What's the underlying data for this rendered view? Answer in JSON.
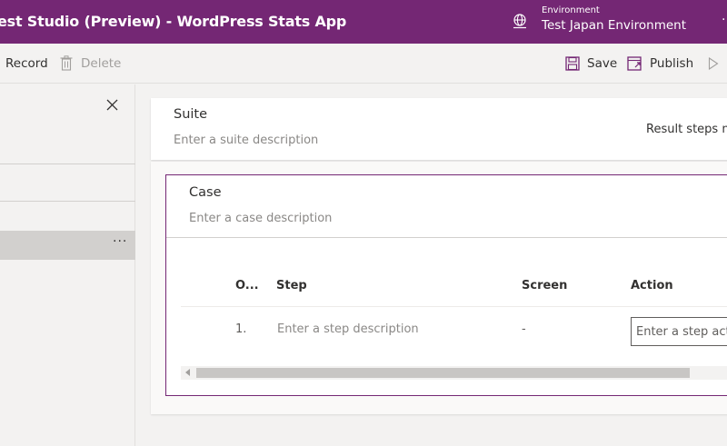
{
  "titlebar": {
    "title": "est Studio (Preview) - WordPress Stats App",
    "env_label": "Environment",
    "env_value": "Test Japan Environment",
    "more": "·"
  },
  "commandbar": {
    "record": "Record",
    "delete": "Delete",
    "save": "Save",
    "publish": "Publish"
  },
  "leftpanel": {
    "more": "···"
  },
  "suite": {
    "title": "Suite",
    "description_placeholder": "Enter a suite description",
    "result_text": "Result steps no"
  },
  "case": {
    "title": "Case",
    "description_placeholder": "Enter a case description",
    "columns": {
      "order": "O...",
      "step": "Step",
      "screen": "Screen",
      "action": "Action"
    },
    "rows": [
      {
        "order": "1.",
        "step_placeholder": "Enter a step description",
        "screen": "-",
        "action_placeholder": "Enter a step action"
      }
    ]
  },
  "colors": {
    "brand": "#742774",
    "background": "#f3f2f1",
    "card": "#ffffff"
  },
  "icons": {
    "environment": "globe-icon",
    "delete": "trash-icon",
    "save": "save-icon",
    "publish": "publish-icon",
    "play": "play-icon",
    "close": "close-icon"
  }
}
